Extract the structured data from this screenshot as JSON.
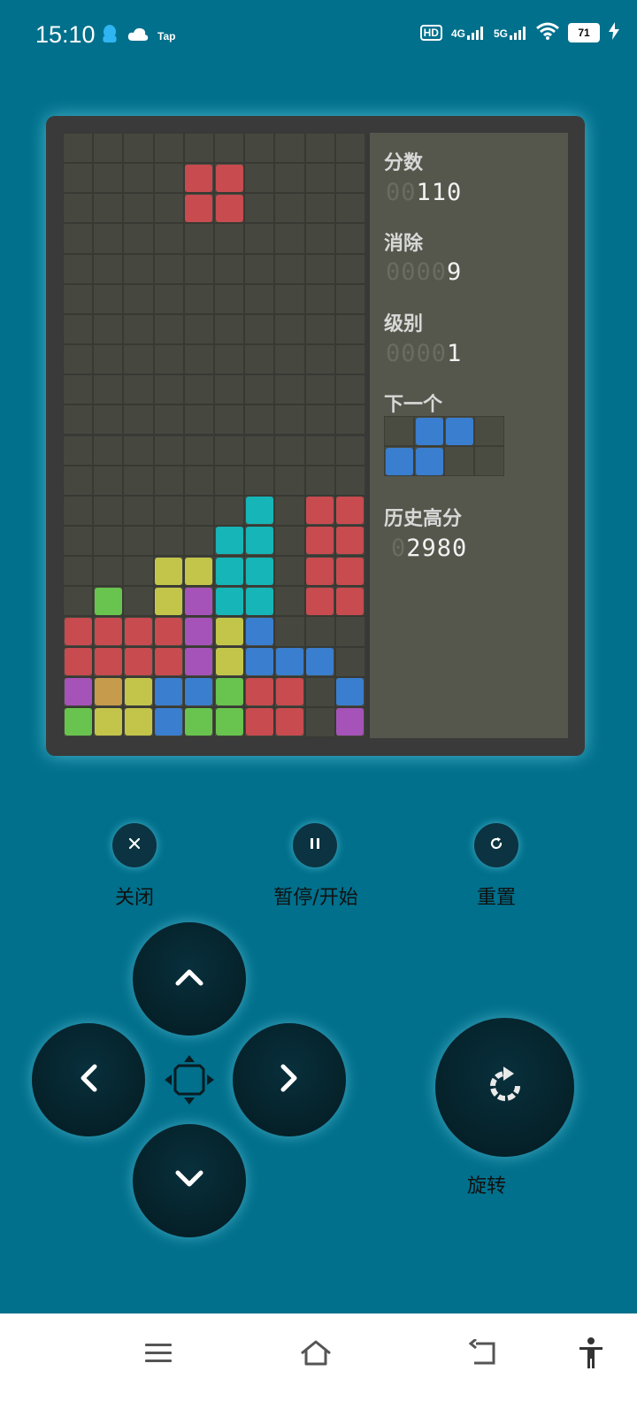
{
  "status_bar": {
    "time": "15:10",
    "left_icons": [
      "qq-icon",
      "cloud-icon",
      "tap-icon"
    ],
    "tap_label": "Tap",
    "hd_label": "HD",
    "sim1_label": "4G",
    "sim2_label": "5G",
    "battery_level": "71"
  },
  "game": {
    "board_cols": 10,
    "board_rows": 20,
    "colors": {
      "red": "#c74b4f",
      "cyan": "#16b5b7",
      "yellow": "#c3c54b",
      "purple": "#a553b8",
      "green": "#68c44e",
      "blue": "#3a7ecf",
      "orange": "#c69b4c"
    },
    "blocks": [
      {
        "col": 4,
        "row": 1,
        "c": "red"
      },
      {
        "col": 5,
        "row": 1,
        "c": "red"
      },
      {
        "col": 4,
        "row": 2,
        "c": "red"
      },
      {
        "col": 5,
        "row": 2,
        "c": "red"
      },
      {
        "col": 6,
        "row": 12,
        "c": "cyan"
      },
      {
        "col": 8,
        "row": 12,
        "c": "red"
      },
      {
        "col": 9,
        "row": 12,
        "c": "red"
      },
      {
        "col": 5,
        "row": 13,
        "c": "cyan"
      },
      {
        "col": 6,
        "row": 13,
        "c": "cyan"
      },
      {
        "col": 8,
        "row": 13,
        "c": "red"
      },
      {
        "col": 9,
        "row": 13,
        "c": "red"
      },
      {
        "col": 3,
        "row": 14,
        "c": "yellow"
      },
      {
        "col": 4,
        "row": 14,
        "c": "yellow"
      },
      {
        "col": 5,
        "row": 14,
        "c": "cyan"
      },
      {
        "col": 6,
        "row": 14,
        "c": "cyan"
      },
      {
        "col": 8,
        "row": 14,
        "c": "red"
      },
      {
        "col": 9,
        "row": 14,
        "c": "red"
      },
      {
        "col": 1,
        "row": 15,
        "c": "green"
      },
      {
        "col": 3,
        "row": 15,
        "c": "yellow"
      },
      {
        "col": 4,
        "row": 15,
        "c": "purple"
      },
      {
        "col": 5,
        "row": 15,
        "c": "cyan"
      },
      {
        "col": 6,
        "row": 15,
        "c": "cyan"
      },
      {
        "col": 8,
        "row": 15,
        "c": "red"
      },
      {
        "col": 9,
        "row": 15,
        "c": "red"
      },
      {
        "col": 0,
        "row": 16,
        "c": "red"
      },
      {
        "col": 1,
        "row": 16,
        "c": "red"
      },
      {
        "col": 2,
        "row": 16,
        "c": "red"
      },
      {
        "col": 3,
        "row": 16,
        "c": "red"
      },
      {
        "col": 4,
        "row": 16,
        "c": "purple"
      },
      {
        "col": 5,
        "row": 16,
        "c": "yellow"
      },
      {
        "col": 6,
        "row": 16,
        "c": "blue"
      },
      {
        "col": 0,
        "row": 17,
        "c": "red"
      },
      {
        "col": 1,
        "row": 17,
        "c": "red"
      },
      {
        "col": 2,
        "row": 17,
        "c": "red"
      },
      {
        "col": 3,
        "row": 17,
        "c": "red"
      },
      {
        "col": 4,
        "row": 17,
        "c": "purple"
      },
      {
        "col": 5,
        "row": 17,
        "c": "yellow"
      },
      {
        "col": 6,
        "row": 17,
        "c": "blue"
      },
      {
        "col": 7,
        "row": 17,
        "c": "blue"
      },
      {
        "col": 8,
        "row": 17,
        "c": "blue"
      },
      {
        "col": 0,
        "row": 18,
        "c": "purple"
      },
      {
        "col": 1,
        "row": 18,
        "c": "orange"
      },
      {
        "col": 2,
        "row": 18,
        "c": "yellow"
      },
      {
        "col": 3,
        "row": 18,
        "c": "blue"
      },
      {
        "col": 4,
        "row": 18,
        "c": "blue"
      },
      {
        "col": 5,
        "row": 18,
        "c": "green"
      },
      {
        "col": 6,
        "row": 18,
        "c": "red"
      },
      {
        "col": 7,
        "row": 18,
        "c": "red"
      },
      {
        "col": 9,
        "row": 18,
        "c": "blue"
      },
      {
        "col": 0,
        "row": 19,
        "c": "green"
      },
      {
        "col": 1,
        "row": 19,
        "c": "yellow"
      },
      {
        "col": 2,
        "row": 19,
        "c": "yellow"
      },
      {
        "col": 3,
        "row": 19,
        "c": "blue"
      },
      {
        "col": 4,
        "row": 19,
        "c": "green"
      },
      {
        "col": 5,
        "row": 19,
        "c": "green"
      },
      {
        "col": 6,
        "row": 19,
        "c": "red"
      },
      {
        "col": 7,
        "row": 19,
        "c": "red"
      },
      {
        "col": 9,
        "row": 19,
        "c": "purple"
      }
    ],
    "score_label": "分数",
    "score_dim": "00",
    "score_value": "110",
    "lines_label": "消除",
    "lines_dim": "0000",
    "lines_value": "9",
    "level_label": "级别",
    "level_dim": "0000",
    "level_value": "1",
    "next_label": "下一个",
    "next_piece": [
      {
        "col": 1,
        "row": 0,
        "c": "blue"
      },
      {
        "col": 2,
        "row": 0,
        "c": "blue"
      },
      {
        "col": 0,
        "row": 1,
        "c": "blue"
      },
      {
        "col": 1,
        "row": 1,
        "c": "blue"
      }
    ],
    "highscore_label": "历史高分",
    "highscore_dim": "0",
    "highscore_value": "2980"
  },
  "controls": {
    "close_label": "关闭",
    "pause_label": "暂停/开始",
    "reset_label": "重置",
    "rotate_label": "旋转"
  }
}
